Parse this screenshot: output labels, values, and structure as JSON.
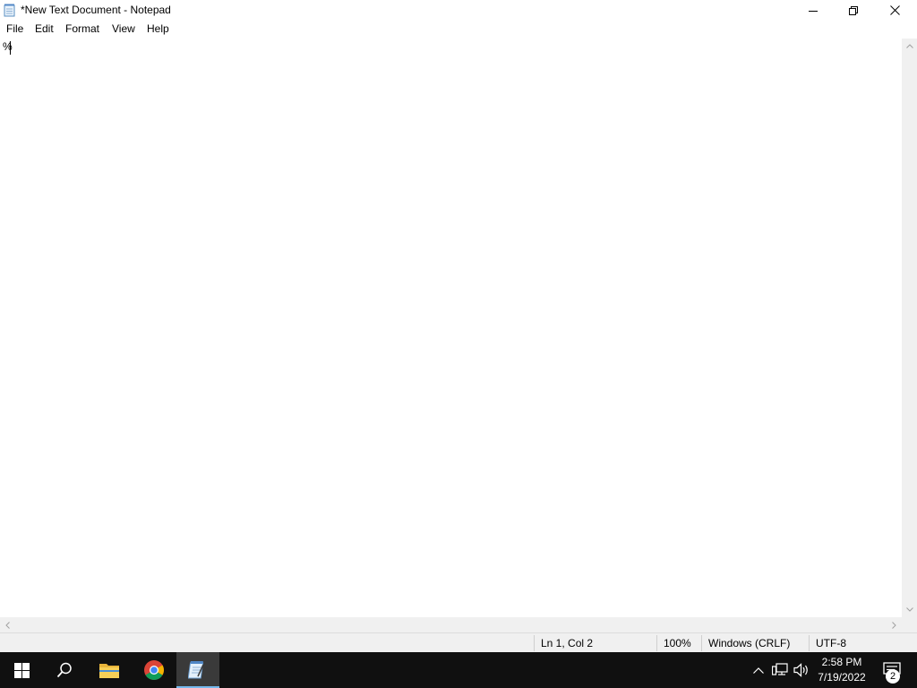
{
  "window": {
    "title": "*New Text Document - Notepad",
    "controls": {
      "minimize": "minimize",
      "restore": "restore",
      "close": "close"
    }
  },
  "menu": {
    "items": [
      {
        "label": "File"
      },
      {
        "label": "Edit"
      },
      {
        "label": "Format"
      },
      {
        "label": "View"
      },
      {
        "label": "Help"
      }
    ]
  },
  "editor": {
    "content": "%"
  },
  "status": {
    "position": "Ln 1, Col 2",
    "zoom": "100%",
    "line_ending": "Windows (CRLF)",
    "encoding": "UTF-8"
  },
  "taskbar": {
    "apps": [
      {
        "name": "start",
        "icon": "windows-logo-icon"
      },
      {
        "name": "search",
        "icon": "search-icon"
      },
      {
        "name": "file-explorer",
        "icon": "folder-icon"
      },
      {
        "name": "chrome",
        "icon": "chrome-icon"
      },
      {
        "name": "notepad",
        "icon": "notepad-icon",
        "active": true
      }
    ],
    "clock": {
      "time": "2:58 PM",
      "date": "7/19/2022"
    },
    "notifications_count": "2"
  },
  "colors": {
    "taskbar_bg": "#101010",
    "active_indicator": "#76b9ed",
    "statusbar_bg": "#f0f0f0"
  }
}
